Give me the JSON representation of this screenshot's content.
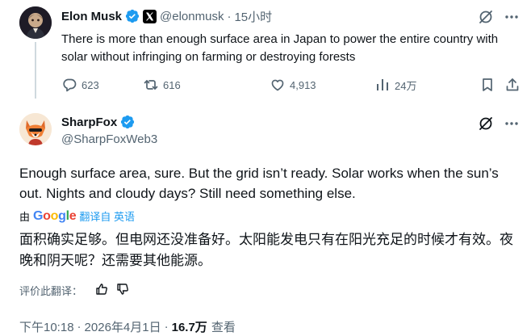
{
  "parent_tweet": {
    "name": "Elon Musk",
    "handle": "@elonmusk",
    "separator": "·",
    "time": "15小时",
    "text": "There is more than enough surface area in Japan to power the entire country with solar without infringing on farming or destroying forests",
    "actions": {
      "replies": "623",
      "reposts": "616",
      "likes": "4,913",
      "views": "24万"
    }
  },
  "main_tweet": {
    "name": "SharpFox",
    "handle": "@SharpFoxWeb3",
    "text": "Enough surface area, sure. But the grid isn’t ready. Solar works when the sun’s out. Nights and cloudy days? Still need something else.",
    "translation": {
      "by_label": "由",
      "provider": "Google",
      "action_label": "翻译自 英语",
      "text": "面积确实足够。但电网还没准备好。太阳能发电只有在阳光充足的时候才有效。夜晚和阴天呢？还需要其他能源。"
    },
    "rate_label": "评价此翻译：",
    "meta": {
      "time": "下午10:18",
      "separator": "·",
      "date": "2026年4月1日",
      "separator2": "·",
      "views_count": "16.7万",
      "views_label": "查看"
    }
  },
  "colors": {
    "text_primary": "#0f1419",
    "text_secondary": "#536471",
    "accent_blue": "#1d9bf0",
    "verified_blue": "#1d9bf0",
    "thread_line": "#cfd9de"
  },
  "icons": {
    "verified": "verified-badge-icon",
    "x_logo": "x-logo-icon",
    "grok": "grok-icon",
    "more": "more-icon",
    "reply": "reply-icon",
    "repost": "repost-icon",
    "like": "like-icon",
    "views": "views-icon",
    "bookmark": "bookmark-icon",
    "share": "share-icon",
    "thumbs_up": "thumbs-up-icon",
    "thumbs_down": "thumbs-down-icon"
  }
}
